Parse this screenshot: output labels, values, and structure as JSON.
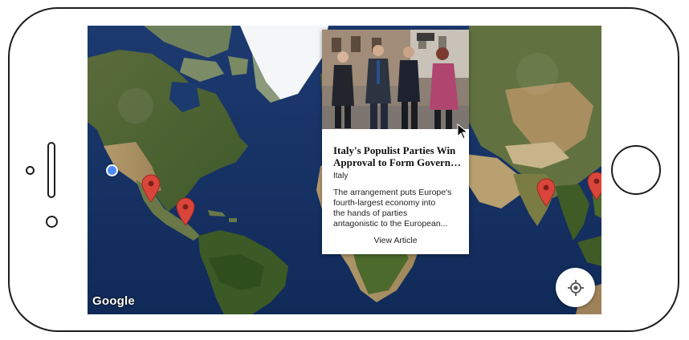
{
  "map": {
    "provider_logo": "Google",
    "locate_button_icon": "my-location-icon",
    "pin_icon": "map-marker-icon",
    "pin_color": "#d9453a",
    "user_location_color": "#4a8bf5",
    "ocean_color": "#14305e"
  },
  "article_card": {
    "headline_line1": "Italy's Populist Parties Win",
    "headline_line2": "Approval to Form Governm...",
    "section": "Italy",
    "summary_lines": [
      "The arrangement puts Europe's",
      "fourth-largest economy into",
      "the hands of parties",
      "antagonistic to the European..."
    ],
    "link_label": "View Article"
  }
}
